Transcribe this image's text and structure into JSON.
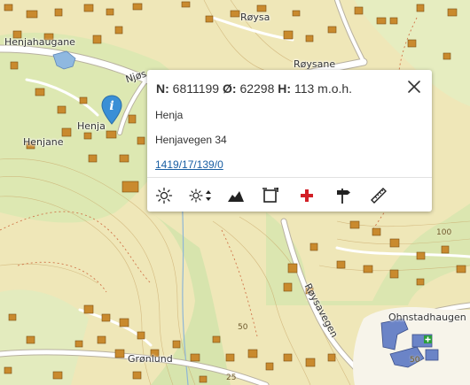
{
  "map": {
    "place_labels": {
      "henjahaugane": "Henjahaugane",
      "roysa": "Røysa",
      "roysane": "Røysane",
      "henja": "Henja",
      "henjane": "Henjane",
      "njos": "Njøs",
      "roysavegen": "Røysavegen",
      "ohnstadhaugen": "Ohnstadhaugen",
      "gronlund": "Grønlund"
    },
    "contour_labels": [
      "100",
      "50",
      "50",
      "25"
    ],
    "colors": {
      "terrain": "#efe7b8",
      "forest": "#d9e6b0",
      "building": "#c9892e",
      "road": "#ffffff",
      "water": "#a9c6e0"
    }
  },
  "popup": {
    "coord_n_label": "N:",
    "coord_n_value": "6811199",
    "coord_o_label": "Ø:",
    "coord_o_value": "62298",
    "coord_h_label": "H:",
    "coord_h_value": "113 m.o.h.",
    "place_name": "Henja",
    "address": "Henjavegen 34",
    "property_link": "1419/17/139/0",
    "tools": [
      "sun-icon",
      "sun-adjust-icon",
      "elevation-profile-icon",
      "frame-icon",
      "emergency-cross-icon",
      "signpost-icon",
      "ruler-icon"
    ]
  }
}
